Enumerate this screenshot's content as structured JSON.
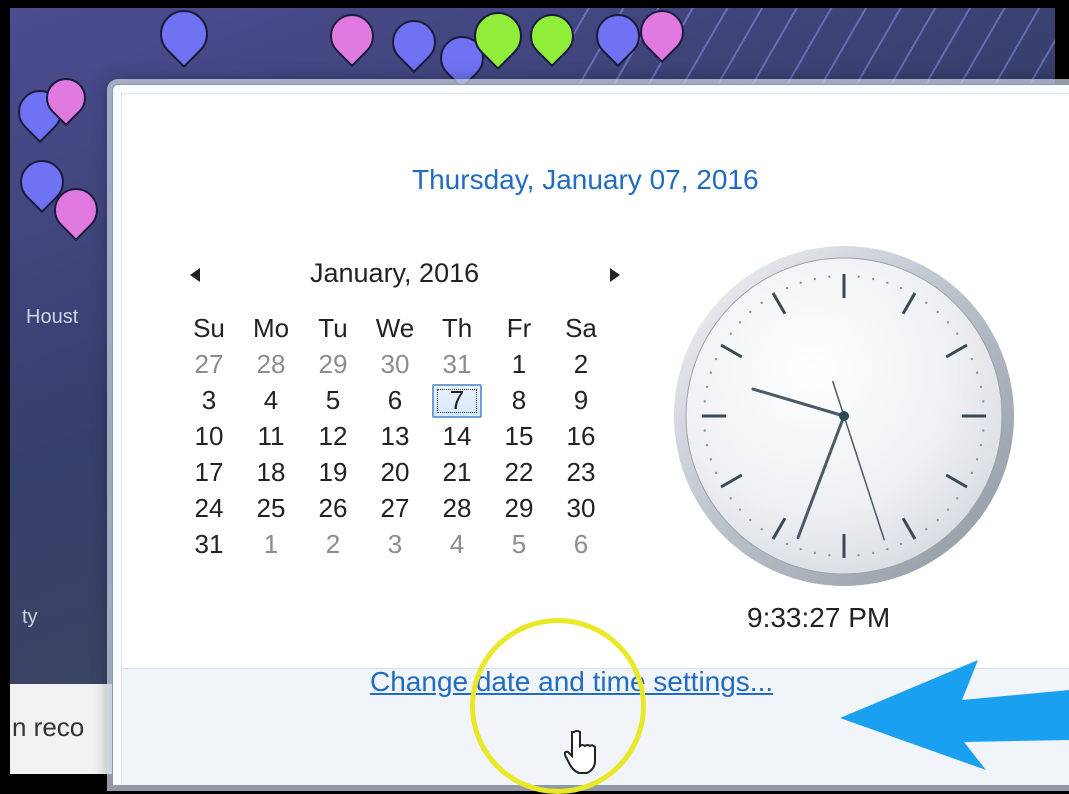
{
  "background": {
    "map_label_city": "Houst",
    "map_label_2": "ty",
    "bottom_text": "n reco"
  },
  "popup": {
    "full_date": "Thursday, January 07, 2016",
    "month_title": "January, 2016",
    "prev_month_icon": "triangle-left-icon",
    "next_month_icon": "triangle-right-icon",
    "weekdays": [
      "Su",
      "Mo",
      "Tu",
      "We",
      "Th",
      "Fr",
      "Sa"
    ],
    "weeks": [
      [
        {
          "d": "27",
          "o": true
        },
        {
          "d": "28",
          "o": true
        },
        {
          "d": "29",
          "o": true
        },
        {
          "d": "30",
          "o": true
        },
        {
          "d": "31",
          "o": true
        },
        {
          "d": "1"
        },
        {
          "d": "2"
        }
      ],
      [
        {
          "d": "3"
        },
        {
          "d": "4"
        },
        {
          "d": "5"
        },
        {
          "d": "6"
        },
        {
          "d": "7",
          "t": true
        },
        {
          "d": "8"
        },
        {
          "d": "9"
        }
      ],
      [
        {
          "d": "10"
        },
        {
          "d": "11"
        },
        {
          "d": "12"
        },
        {
          "d": "13"
        },
        {
          "d": "14"
        },
        {
          "d": "15"
        },
        {
          "d": "16"
        }
      ],
      [
        {
          "d": "17"
        },
        {
          "d": "18"
        },
        {
          "d": "19"
        },
        {
          "d": "20"
        },
        {
          "d": "21"
        },
        {
          "d": "22"
        },
        {
          "d": "23"
        }
      ],
      [
        {
          "d": "24"
        },
        {
          "d": "25"
        },
        {
          "d": "26"
        },
        {
          "d": "27"
        },
        {
          "d": "28"
        },
        {
          "d": "29"
        },
        {
          "d": "30"
        }
      ],
      [
        {
          "d": "31"
        },
        {
          "d": "1",
          "o": true
        },
        {
          "d": "2",
          "o": true
        },
        {
          "d": "3",
          "o": true
        },
        {
          "d": "4",
          "o": true
        },
        {
          "d": "5",
          "o": true
        },
        {
          "d": "6",
          "o": true
        }
      ]
    ],
    "time": "9:33:27 PM",
    "change_link": "Change date and time settings...",
    "clock": {
      "hour": 9,
      "minute": 33,
      "second": 27
    }
  },
  "colors": {
    "link": "#1f6cc2",
    "highlight": "#e8e826",
    "annotation_arrow": "#1aa0f0"
  }
}
